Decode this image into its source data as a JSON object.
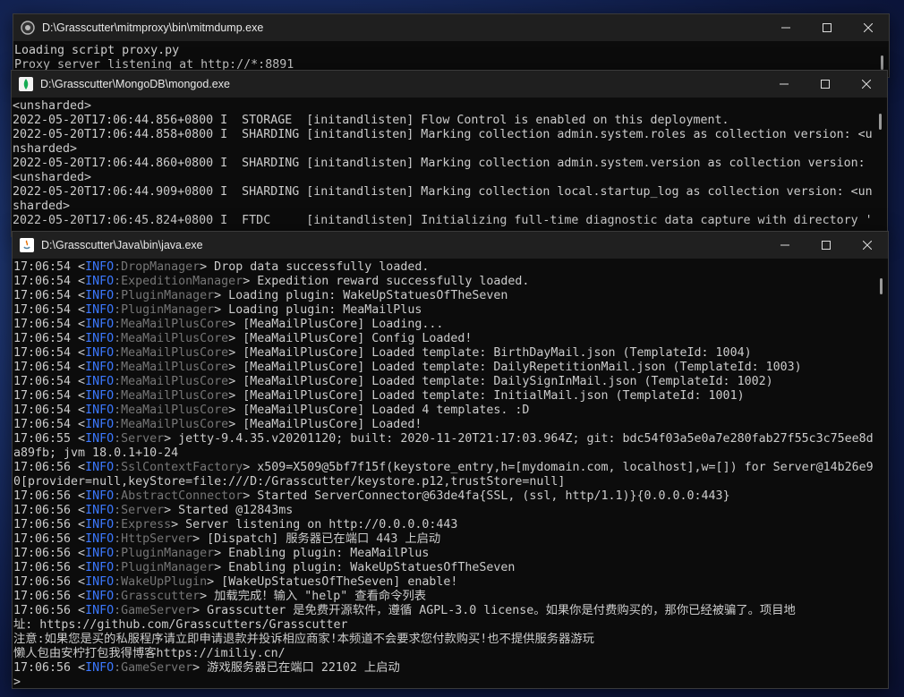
{
  "windows": {
    "mitm": {
      "title": "D:\\Grasscutter\\mitmproxy\\bin\\mitmdump.exe",
      "lines": [
        "Loading script proxy.py",
        "Proxy server listening at http://*:8891"
      ]
    },
    "mongo": {
      "title": "D:\\Grasscutter\\MongoDB\\mongod.exe",
      "lines": [
        "<unsharded>",
        "2022-05-20T17:06:44.856+0800 I  STORAGE  [initandlisten] Flow Control is enabled on this deployment.",
        "2022-05-20T17:06:44.858+0800 I  SHARDING [initandlisten] Marking collection admin.system.roles as collection version: <u",
        "nsharded>",
        "2022-05-20T17:06:44.860+0800 I  SHARDING [initandlisten] Marking collection admin.system.version as collection version:",
        "<unsharded>",
        "2022-05-20T17:06:44.909+0800 I  SHARDING [initandlisten] Marking collection local.startup_log as collection version: <un",
        "sharded>",
        "2022-05-20T17:06:45.824+0800 I  FTDC     [initandlisten] Initializing full-time diagnostic data capture with directory '"
      ]
    },
    "java": {
      "title": "D:\\Grasscutter\\Java\\bin\\java.exe",
      "lines": [
        {
          "t": "17:06:54 ",
          "lvl": "INFO",
          "src": "DropManager",
          "msg": "> Drop data successfully loaded."
        },
        {
          "t": "17:06:54 ",
          "lvl": "INFO",
          "src": "ExpeditionManager",
          "msg": "> Expedition reward successfully loaded."
        },
        {
          "t": "17:06:54 ",
          "lvl": "INFO",
          "src": "PluginManager",
          "msg": "> Loading plugin: WakeUpStatuesOfTheSeven"
        },
        {
          "t": "17:06:54 ",
          "lvl": "INFO",
          "src": "PluginManager",
          "msg": "> Loading plugin: MeaMailPlus"
        },
        {
          "t": "17:06:54 ",
          "lvl": "INFO",
          "src": "MeaMailPlusCore",
          "msg": "> [MeaMailPlusCore] Loading..."
        },
        {
          "t": "17:06:54 ",
          "lvl": "INFO",
          "src": "MeaMailPlusCore",
          "msg": "> [MeaMailPlusCore] Config Loaded!"
        },
        {
          "t": "17:06:54 ",
          "lvl": "INFO",
          "src": "MeaMailPlusCore",
          "msg": "> [MeaMailPlusCore] Loaded template: BirthDayMail.json (TemplateId: 1004)"
        },
        {
          "t": "17:06:54 ",
          "lvl": "INFO",
          "src": "MeaMailPlusCore",
          "msg": "> [MeaMailPlusCore] Loaded template: DailyRepetitionMail.json (TemplateId: 1003)"
        },
        {
          "t": "17:06:54 ",
          "lvl": "INFO",
          "src": "MeaMailPlusCore",
          "msg": "> [MeaMailPlusCore] Loaded template: DailySignInMail.json (TemplateId: 1002)"
        },
        {
          "t": "17:06:54 ",
          "lvl": "INFO",
          "src": "MeaMailPlusCore",
          "msg": "> [MeaMailPlusCore] Loaded template: InitialMail.json (TemplateId: 1001)"
        },
        {
          "t": "17:06:54 ",
          "lvl": "INFO",
          "src": "MeaMailPlusCore",
          "msg": "> [MeaMailPlusCore] Loaded 4 templates. :D"
        },
        {
          "t": "17:06:54 ",
          "lvl": "INFO",
          "src": "MeaMailPlusCore",
          "msg": "> [MeaMailPlusCore] Loaded!"
        },
        {
          "t": "17:06:55 ",
          "lvl": "INFO",
          "src": "Server",
          "msg": "> jetty-9.4.35.v20201120; built: 2020-11-20T21:17:03.964Z; git: bdc54f03a5e0a7e280fab27f55c3c75ee8d"
        },
        {
          "raw": "a89fb; jvm 18.0.1+10-24"
        },
        {
          "t": "17:06:56 ",
          "lvl": "INFO",
          "src": "SslContextFactory",
          "msg": "> x509=X509@5bf7f15f(keystore_entry,h=[mydomain.com, localhost],w=[]) for Server@14b26e9"
        },
        {
          "raw": "0[provider=null,keyStore=file:///D:/Grasscutter/keystore.p12,trustStore=null]"
        },
        {
          "t": "17:06:56 ",
          "lvl": "INFO",
          "src": "AbstractConnector",
          "msg": "> Started ServerConnector@63de4fa{SSL, (ssl, http/1.1)}{0.0.0.0:443}"
        },
        {
          "t": "17:06:56 ",
          "lvl": "INFO",
          "src": "Server",
          "msg": "> Started @12843ms"
        },
        {
          "t": "17:06:56 ",
          "lvl": "INFO",
          "src": "Express",
          "msg": "> Server listening on http://0.0.0.0:443"
        },
        {
          "t": "17:06:56 ",
          "lvl": "INFO",
          "src": "HttpServer",
          "msg": "> [Dispatch] 服务器已在端口 443 上启动"
        },
        {
          "t": "17:06:56 ",
          "lvl": "INFO",
          "src": "PluginManager",
          "msg": "> Enabling plugin: MeaMailPlus"
        },
        {
          "t": "17:06:56 ",
          "lvl": "INFO",
          "src": "PluginManager",
          "msg": "> Enabling plugin: WakeUpStatuesOfTheSeven"
        },
        {
          "t": "17:06:56 ",
          "lvl": "INFO",
          "src": "WakeUpPlugin",
          "msg": "> [WakeUpStatuesOfTheSeven] enable!"
        },
        {
          "t": "17:06:56 ",
          "lvl": "INFO",
          "src": "Grasscutter",
          "msg": "> 加载完成！输入 \"help\" 查看命令列表"
        },
        {
          "t": "17:06:56 ",
          "lvl": "INFO",
          "src": "GameServer",
          "msg": "> Grasscutter 是免费开源软件，遵循 AGPL-3.0 license。如果你是付费购买的，那你已经被骗了。项目地"
        },
        {
          "raw": "址: https://github.com/Grasscutters/Grasscutter"
        },
        {
          "raw": "注意:如果您是买的私服程序请立即申请退款并投诉相应商家!本频道不会要求您付款购买!也不提供服务器游玩"
        },
        {
          "raw": "懒人包由安柠打包我得博客https://imiliy.cn/"
        },
        {
          "t": "17:06:56 ",
          "lvl": "INFO",
          "src": "GameServer",
          "msg": "> 游戏服务器已在端口 22102 上启动"
        },
        {
          "raw": ">"
        }
      ]
    }
  }
}
